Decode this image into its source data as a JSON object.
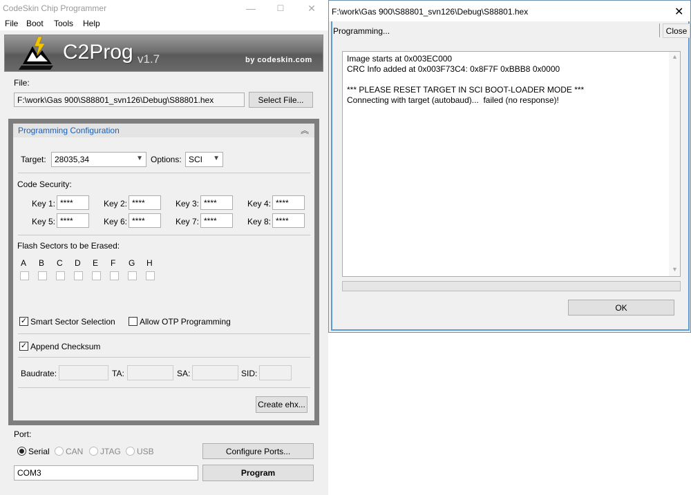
{
  "main_window": {
    "title": "CodeSkin Chip Programmer",
    "minimize": "—",
    "maximize": "☐",
    "close": "✕",
    "menu": [
      "File",
      "Boot",
      "Tools",
      "Help"
    ]
  },
  "banner": {
    "title": "C2Prog",
    "version": "v1.7",
    "by": "by codeskin.com"
  },
  "file": {
    "group_label": "File:",
    "path": "F:\\work\\Gas 900\\S88801_svn126\\Debug\\S88801.hex",
    "select_button": "Select File..."
  },
  "config": {
    "title": "Programming Configuration",
    "collapse_glyph": "︽",
    "target_label": "Target:",
    "target_value": "28035,34",
    "options_label": "Options:",
    "options_value": "SCI",
    "code_security_label": "Code Security:",
    "keys": [
      {
        "label": "Key 1:",
        "value": "****"
      },
      {
        "label": "Key 2:",
        "value": "****"
      },
      {
        "label": "Key 3:",
        "value": "****"
      },
      {
        "label": "Key 4:",
        "value": "****"
      },
      {
        "label": "Key 5:",
        "value": "****"
      },
      {
        "label": "Key 6:",
        "value": "****"
      },
      {
        "label": "Key 7:",
        "value": "****"
      },
      {
        "label": "Key 8:",
        "value": "****"
      }
    ],
    "flash_label": "Flash Sectors to be Erased:",
    "sectors": [
      "A",
      "B",
      "C",
      "D",
      "E",
      "F",
      "G",
      "H"
    ],
    "smart_sector_label": "Smart Sector Selection",
    "smart_sector_checked": true,
    "allow_otp_label": "Allow OTP Programming",
    "allow_otp_checked": false,
    "append_checksum_label": "Append Checksum",
    "append_checksum_checked": true,
    "baudrate_label": "Baudrate:",
    "ta_label": "TA:",
    "sa_label": "SA:",
    "sid_label": "SID:",
    "create_ehx_button": "Create ehx..."
  },
  "port": {
    "group_label": "Port:",
    "options": [
      {
        "label": "Serial",
        "selected": true,
        "enabled": true
      },
      {
        "label": "CAN",
        "selected": false,
        "enabled": false
      },
      {
        "label": "JTAG",
        "selected": false,
        "enabled": false
      },
      {
        "label": "USB",
        "selected": false,
        "enabled": false
      }
    ],
    "configure_button": "Configure Ports...",
    "port_value": "COM3",
    "program_button": "Program"
  },
  "dialog": {
    "title": "F:\\work\\Gas 900\\S88801_svn126\\Debug\\S88801.hex",
    "close_x": "✕",
    "status": "Programming...",
    "close_button": "Close",
    "log": [
      "Image starts at 0x003EC000",
      "CRC Info added at 0x003F73C4: 0x8F7F 0xBBB8 0x0000",
      "",
      "*** PLEASE RESET TARGET IN SCI BOOT-LOADER MODE ***",
      "Connecting with target (autobaud)...  failed (no response)!"
    ],
    "progress": 0,
    "ok_button": "OK"
  }
}
